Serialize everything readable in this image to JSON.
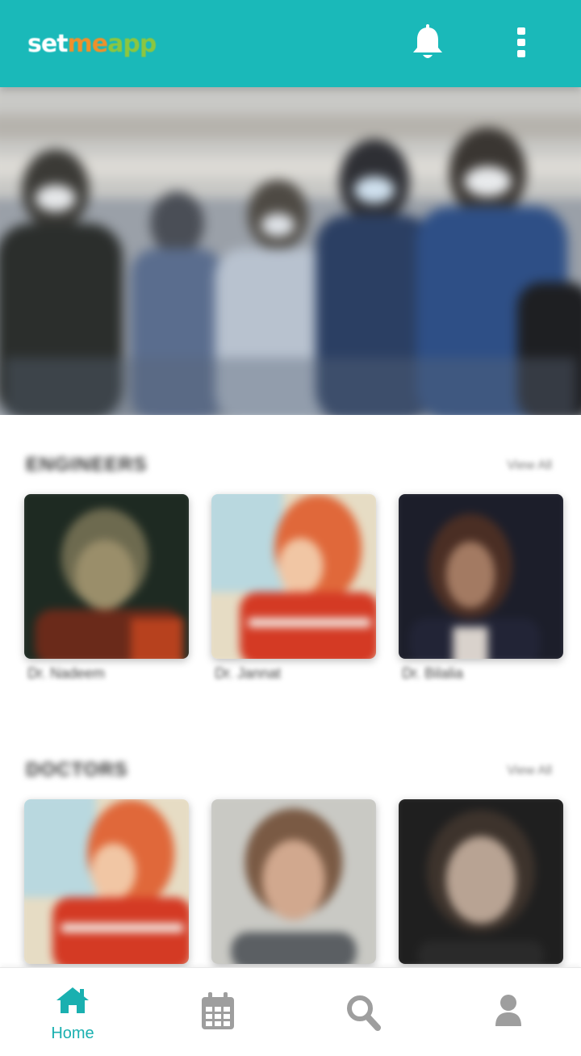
{
  "app": {
    "logo_part1": "set",
    "logo_part2": "me",
    "logo_part3": "app",
    "accent_color": "#1ab9b9"
  },
  "header": {
    "icons": [
      "bell-icon",
      "more-vert-icon"
    ]
  },
  "hero": {
    "description_icon": "hero-banner-image"
  },
  "sections": [
    {
      "title": "ENGINEERS",
      "view_all": "View All",
      "cards": [
        {
          "name": "Dr. Nadeem"
        },
        {
          "name": "Dr. Jannat"
        },
        {
          "name": "Dr. Bilalia"
        }
      ]
    },
    {
      "title": "DOCTORS",
      "view_all": "View All",
      "cards": [
        {
          "name": ""
        },
        {
          "name": ""
        },
        {
          "name": ""
        }
      ]
    }
  ],
  "bottom_nav": {
    "active": "home",
    "items": [
      {
        "id": "home",
        "label": "Home",
        "icon": "home-icon"
      },
      {
        "id": "calendar",
        "label": "",
        "icon": "calendar-icon"
      },
      {
        "id": "search",
        "label": "",
        "icon": "search-icon"
      },
      {
        "id": "profile",
        "label": "",
        "icon": "user-icon"
      }
    ]
  }
}
